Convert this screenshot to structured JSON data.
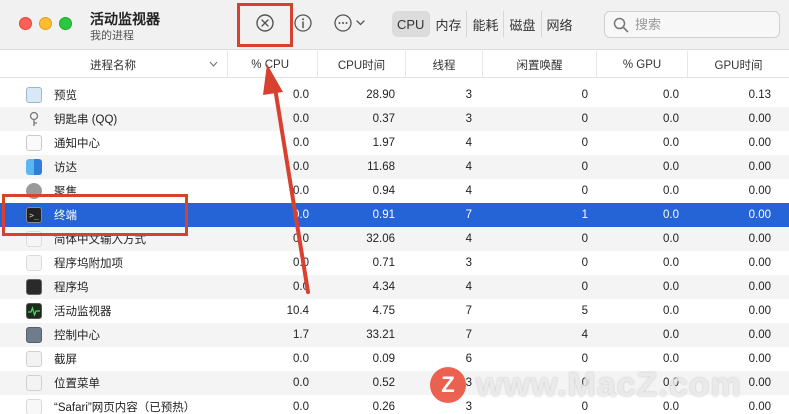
{
  "window": {
    "title": "活动监视器",
    "subtitle": "我的进程"
  },
  "tabs": [
    {
      "label": "CPU",
      "active": true
    },
    {
      "label": "内存",
      "active": false
    },
    {
      "label": "能耗",
      "active": false
    },
    {
      "label": "磁盘",
      "active": false
    },
    {
      "label": "网络",
      "active": false
    }
  ],
  "search": {
    "placeholder": "搜索",
    "value": ""
  },
  "icons": {
    "stop": "stop-process-icon",
    "info": "info-icon",
    "more": "more-actions-icon",
    "search": "search-icon"
  },
  "columns": {
    "name": "进程名称",
    "cpu": "% CPU",
    "cpu_time": "CPU时间",
    "threads": "线程",
    "idle_wakes": "闲置唤醒",
    "gpu": "% GPU",
    "gpu_time": "GPU时间"
  },
  "rows": [
    {
      "name": "预览",
      "cpu": "0.0",
      "cpu_time": "28.90",
      "threads": "3",
      "idle_wakes": "0",
      "gpu": "0.0",
      "gpu_time": "0.13"
    },
    {
      "name": "钥匙串 (QQ)",
      "cpu": "0.0",
      "cpu_time": "0.37",
      "threads": "3",
      "idle_wakes": "0",
      "gpu": "0.0",
      "gpu_time": "0.00"
    },
    {
      "name": "通知中心",
      "cpu": "0.0",
      "cpu_time": "1.97",
      "threads": "4",
      "idle_wakes": "0",
      "gpu": "0.0",
      "gpu_time": "0.00"
    },
    {
      "name": "访达",
      "cpu": "0.0",
      "cpu_time": "11.68",
      "threads": "4",
      "idle_wakes": "0",
      "gpu": "0.0",
      "gpu_time": "0.00"
    },
    {
      "name": "聚焦",
      "cpu": "0.0",
      "cpu_time": "0.94",
      "threads": "4",
      "idle_wakes": "0",
      "gpu": "0.0",
      "gpu_time": "0.00"
    },
    {
      "name": "终端",
      "cpu": "0.0",
      "cpu_time": "0.91",
      "threads": "7",
      "idle_wakes": "1",
      "gpu": "0.0",
      "gpu_time": "0.00"
    },
    {
      "name": "简体中文输入方式",
      "cpu": "0.0",
      "cpu_time": "32.06",
      "threads": "4",
      "idle_wakes": "0",
      "gpu": "0.0",
      "gpu_time": "0.00"
    },
    {
      "name": "程序坞附加项",
      "cpu": "0.0",
      "cpu_time": "0.71",
      "threads": "3",
      "idle_wakes": "0",
      "gpu": "0.0",
      "gpu_time": "0.00"
    },
    {
      "name": "程序坞",
      "cpu": "0.0",
      "cpu_time": "4.34",
      "threads": "4",
      "idle_wakes": "0",
      "gpu": "0.0",
      "gpu_time": "0.00"
    },
    {
      "name": "活动监视器",
      "cpu": "10.4",
      "cpu_time": "4.75",
      "threads": "7",
      "idle_wakes": "5",
      "gpu": "0.0",
      "gpu_time": "0.00"
    },
    {
      "name": "控制中心",
      "cpu": "1.7",
      "cpu_time": "33.21",
      "threads": "7",
      "idle_wakes": "4",
      "gpu": "0.0",
      "gpu_time": "0.00"
    },
    {
      "name": "截屏",
      "cpu": "0.0",
      "cpu_time": "0.09",
      "threads": "6",
      "idle_wakes": "0",
      "gpu": "0.0",
      "gpu_time": "0.00"
    },
    {
      "name": "位置菜单",
      "cpu": "0.0",
      "cpu_time": "0.52",
      "threads": "3",
      "idle_wakes": "0",
      "gpu": "0.0",
      "gpu_time": "0.00"
    },
    {
      "name": "“Safari”网页内容（已预热）",
      "cpu": "0.0",
      "cpu_time": "0.26",
      "threads": "3",
      "idle_wakes": "0",
      "gpu": "0.0",
      "gpu_time": "0.00"
    }
  ],
  "selected_row": "终端",
  "watermark": {
    "logo": "Z",
    "text": "www.MacZ.com"
  },
  "colors": {
    "selection": "#2464d6",
    "annotation_red": "#d8412f"
  }
}
